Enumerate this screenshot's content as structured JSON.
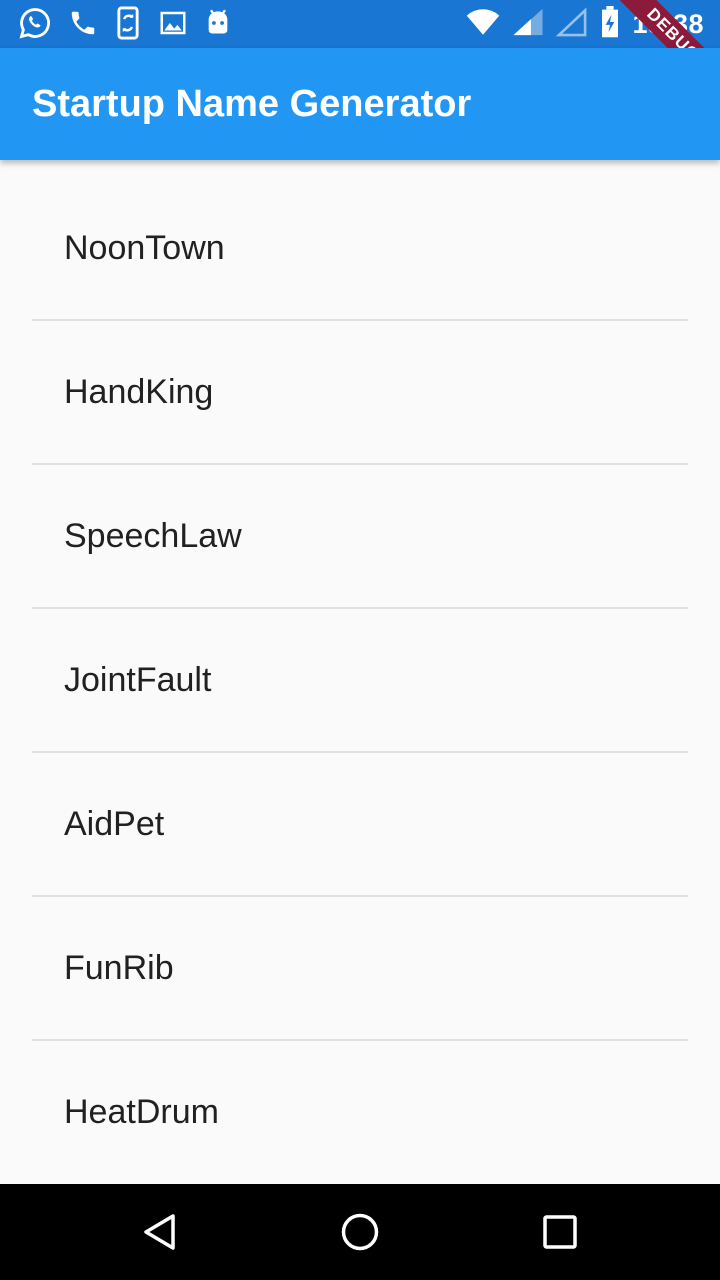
{
  "status_bar": {
    "time": "18:38",
    "icons_left": [
      "whatsapp-icon",
      "phone-icon",
      "screen-rotation-icon",
      "image-icon",
      "android-icon"
    ],
    "icons_right": [
      "wifi-icon",
      "signal-icon",
      "signal-empty-icon",
      "battery-charging-icon"
    ]
  },
  "debug_banner": {
    "label": "DEBUG"
  },
  "app_bar": {
    "title": "Startup Name Generator"
  },
  "list": {
    "items": [
      {
        "label": "NoonTown"
      },
      {
        "label": "HandKing"
      },
      {
        "label": "SpeechLaw"
      },
      {
        "label": "JointFault"
      },
      {
        "label": "AidPet"
      },
      {
        "label": "FunRib"
      },
      {
        "label": "HeatDrum"
      }
    ]
  },
  "nav_bar": {
    "buttons": [
      "back-icon",
      "home-icon",
      "recents-icon"
    ]
  },
  "colors": {
    "status_bar": "#1976d2",
    "app_bar": "#2196f3",
    "debug_banner": "#8b1a3b",
    "background": "#fafafa"
  }
}
